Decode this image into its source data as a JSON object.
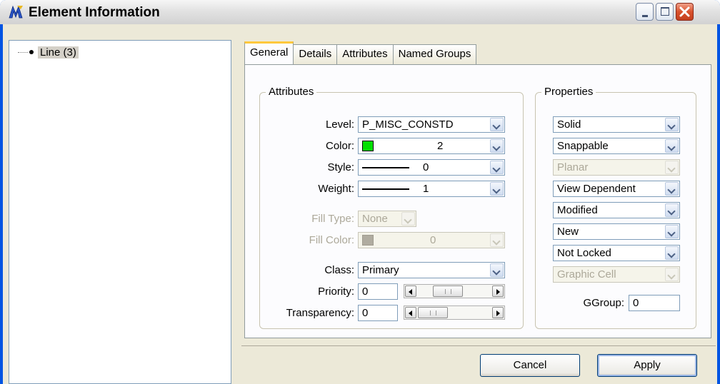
{
  "window": {
    "title": "Element Information"
  },
  "tree": {
    "items": [
      {
        "label": "Line (3)"
      }
    ]
  },
  "tabs": [
    {
      "label": "General",
      "active": true
    },
    {
      "label": "Details",
      "active": false
    },
    {
      "label": "Attributes",
      "active": false
    },
    {
      "label": "Named Groups",
      "active": false
    }
  ],
  "attributes": {
    "legend": "Attributes",
    "level": {
      "label": "Level:",
      "value": "P_MISC_CONSTD"
    },
    "color": {
      "label": "Color:",
      "value": "2",
      "swatch": "#00e000"
    },
    "style": {
      "label": "Style:",
      "value": "0"
    },
    "weight": {
      "label": "Weight:",
      "value": "1"
    },
    "fill_type": {
      "label": "Fill Type:",
      "value": "None"
    },
    "fill_color": {
      "label": "Fill Color:",
      "value": "0",
      "swatch": "#b0aca0"
    },
    "class": {
      "label": "Class:",
      "value": "Primary"
    },
    "priority": {
      "label": "Priority:",
      "value": "0"
    },
    "transparency": {
      "label": "Transparency:",
      "value": "0"
    }
  },
  "properties": {
    "legend": "Properties",
    "items": [
      {
        "value": "Solid",
        "enabled": true
      },
      {
        "value": "Snappable",
        "enabled": true
      },
      {
        "value": "Planar",
        "enabled": false
      },
      {
        "value": "View Dependent",
        "enabled": true
      },
      {
        "value": "Modified",
        "enabled": true
      },
      {
        "value": "New",
        "enabled": true
      },
      {
        "value": "Not Locked",
        "enabled": true
      },
      {
        "value": "Graphic Cell",
        "enabled": false
      }
    ],
    "ggroup": {
      "label": "GGroup:",
      "value": "0"
    }
  },
  "buttons": {
    "cancel": "Cancel",
    "apply": "Apply"
  }
}
